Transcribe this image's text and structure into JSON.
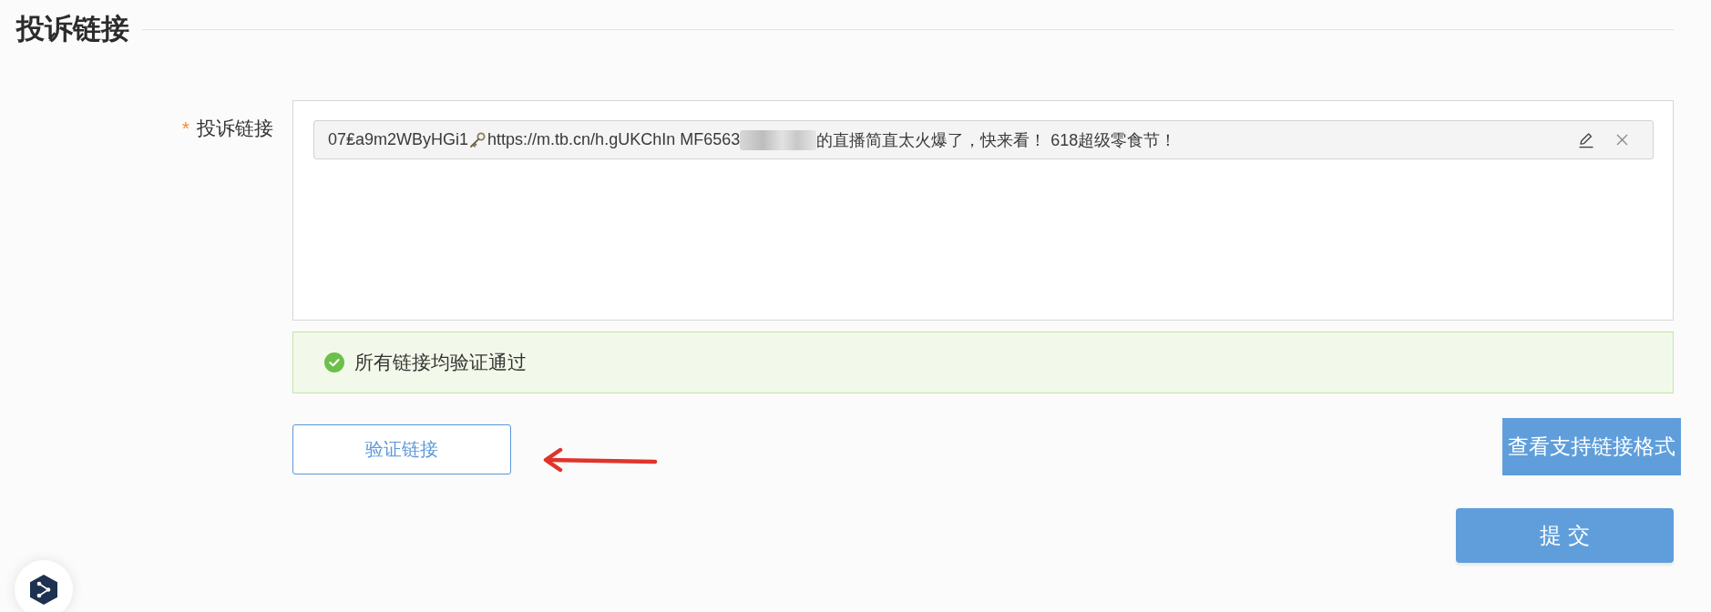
{
  "page_title": "投诉链接",
  "complaint_links": {
    "label": "投诉链接",
    "required_mark": "*",
    "links": [
      {
        "parts": [
          {
            "kind": "text",
            "text": "07₤a9m2WByHGi1"
          },
          {
            "kind": "key"
          },
          {
            "kind": "text",
            "text": "https://m.tb.cn/h.gUKChIn MF6563"
          },
          {
            "kind": "redacted"
          },
          {
            "kind": "text",
            "text": "的直播简直太火爆了，快来看！ 618超级零食节！"
          }
        ]
      }
    ]
  },
  "validation_alert": {
    "kind": "success",
    "message": "所有链接均验证通过"
  },
  "verify_button": "验证链接",
  "formats_button": "查看支持链接格式",
  "submit_button": "提 交"
}
